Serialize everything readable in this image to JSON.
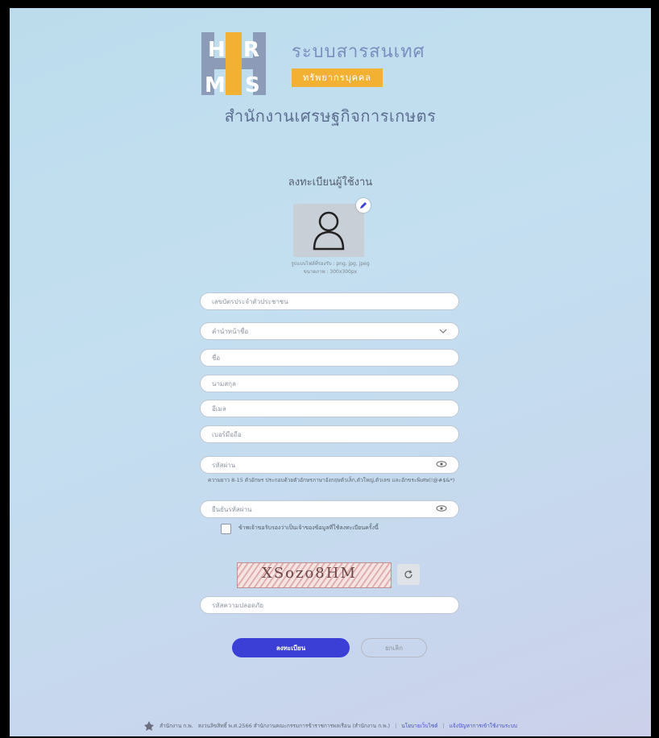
{
  "logo": {
    "title": "ระบบสารสนเทศ",
    "subtitle": "ทรัพยากรบุคคล"
  },
  "org_title": "สำนักงานเศรษฐกิจการเกษตร",
  "form": {
    "title": "ลงทะเบียนผู้ใช้งาน",
    "avatar_hint_1": "รูปแบบไฟล์ที่รองรับ : png, jpg, jpeg",
    "avatar_hint_2": "ขนาดภาพ : 300x300px",
    "id_card_placeholder": "เลขบัตรประจำตัวประชาชน",
    "prefix_placeholder": "คำนำหน้าชื่อ",
    "first_name_placeholder": "ชื่อ",
    "last_name_placeholder": "นามสกุล",
    "email_placeholder": "อีเมล",
    "phone_placeholder": "เบอร์มือถือ",
    "password_placeholder": "รหัสผ่าน",
    "password_hint": "ความยาว 8-15 ตัวอักษร ประกอบด้วยตัวอักษรภาษาอังกฤษตัวเล็ก,ตัวใหญ่,ตัวเลข และอักขระพิเศษ(!@#$&*)",
    "confirm_password_placeholder": "ยืนยันรหัสผ่าน",
    "consent_label": "ข้าพเจ้าขอรับรองว่าเป็นเจ้าของข้อมูลที่ใช้ลงทะเบียนครั้งนี้",
    "captcha_text": "XSozo8HM",
    "captcha_placeholder": "รหัสความปลอดภัย",
    "submit_label": "ลงทะเบียน",
    "cancel_label": "ยกเลิก"
  },
  "footer": {
    "brand": "สำนักงาน ก.พ.",
    "copyright": "สงวนลิขสิทธิ์ พ.ศ.2566 สำนักงานคณะกรรมการข้าราชการพลเรือน (สำนักงาน ก.พ.)",
    "sep": "|",
    "policy_link": "นโยบายเว็บไซต์",
    "help_link": "แจ้งปัญหาการเข้าใช้งานระบบ"
  },
  "colors": {
    "primary": "#3b3fd6",
    "logo_accent": "#f2b133",
    "logo_text": "#7b8ec0"
  },
  "icons": [
    "hrms-logo",
    "user-avatar-icon",
    "edit-pencil-icon",
    "chevron-down-icon",
    "eye-icon",
    "refresh-icon",
    "ocsc-logo-icon"
  ]
}
